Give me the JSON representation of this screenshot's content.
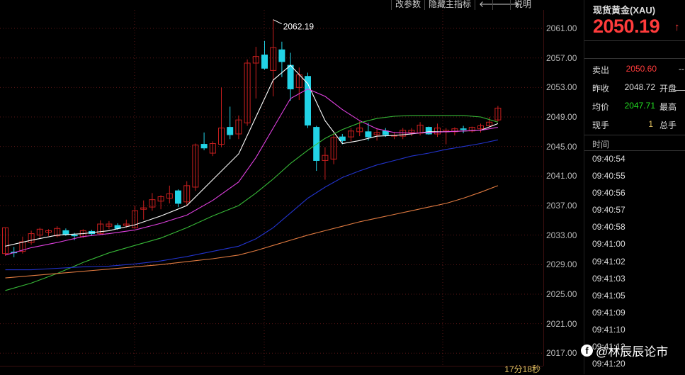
{
  "toolbar": {
    "params_label": "改参数",
    "hide_indicator_label": "隐藏主指标",
    "left_arrow": "🡐",
    "right_arrow": "🡒",
    "help_label": "说明"
  },
  "countdown": "17分18秒",
  "side_panel": {
    "title": "现货黄金(XAU)",
    "price": "2050.19",
    "price_arrow": "↑",
    "minus": "—",
    "rows": {
      "sell": {
        "label": "卖出",
        "value": "2050.60",
        "right_label": "--"
      },
      "prev_close": {
        "label": "昨收",
        "value": "2048.72",
        "right_label": "开盘"
      },
      "avg": {
        "label": "均价",
        "value": "2047.71",
        "right_label": "最高"
      },
      "volume": {
        "label": "现手",
        "value": "1",
        "right_label": "总手"
      }
    },
    "time_header": "时间",
    "times": [
      "09:40:54",
      "09:40:55",
      "09:40:56",
      "09:40:57",
      "09:40:58",
      "09:41:00",
      "09:41:02",
      "09:41:03",
      "09:41:05",
      "09:41:09",
      "09:41:10",
      "09:41:12",
      "09:41:20"
    ]
  },
  "watermark": "@林辰辰论市",
  "colors": {
    "up": "#c81e1e",
    "down": "#22d3e6",
    "price_red": "#ff3b3b",
    "green": "#22dd22",
    "ma_white": "#ffffff",
    "ma_magenta": "#e040e0",
    "ma_green": "#37b837",
    "ma_blue": "#2233cc",
    "ma_orange": "#e07a40"
  },
  "chart_data": {
    "type": "candlestick",
    "y_ticks": [
      "2061.00",
      "2057.00",
      "2053.00",
      "2049.00",
      "2045.00",
      "2041.00",
      "2037.00",
      "2033.00",
      "2029.00",
      "2025.00",
      "2021.00",
      "2017.00"
    ],
    "ylim": [
      2015.3,
      2063.5
    ],
    "high_annotation": "2062.19",
    "high_value": 2062.19,
    "high_index": 31,
    "candles": [
      {
        "o": 2030.5,
        "h": 2034.0,
        "l": 2030.2,
        "c": 2034.0
      },
      {
        "o": 2030.7,
        "h": 2031.4,
        "l": 2030.0,
        "c": 2030.6
      },
      {
        "o": 2030.8,
        "h": 2032.8,
        "l": 2030.5,
        "c": 2032.1
      },
      {
        "o": 2032.0,
        "h": 2033.6,
        "l": 2031.7,
        "c": 2033.2
      },
      {
        "o": 2033.0,
        "h": 2034.0,
        "l": 2032.5,
        "c": 2033.8
      },
      {
        "o": 2033.4,
        "h": 2033.8,
        "l": 2032.9,
        "c": 2033.6
      },
      {
        "o": 2032.9,
        "h": 2034.2,
        "l": 2032.7,
        "c": 2033.9
      },
      {
        "o": 2033.6,
        "h": 2033.9,
        "l": 2032.9,
        "c": 2033.1
      },
      {
        "o": 2033.0,
        "h": 2033.3,
        "l": 2032.3,
        "c": 2032.9
      },
      {
        "o": 2032.8,
        "h": 2033.8,
        "l": 2032.6,
        "c": 2033.6
      },
      {
        "o": 2033.5,
        "h": 2033.7,
        "l": 2032.9,
        "c": 2033.2
      },
      {
        "o": 2033.2,
        "h": 2035.0,
        "l": 2033.1,
        "c": 2034.5
      },
      {
        "o": 2034.2,
        "h": 2034.9,
        "l": 2033.8,
        "c": 2034.5
      },
      {
        "o": 2034.3,
        "h": 2034.6,
        "l": 2033.7,
        "c": 2033.9
      },
      {
        "o": 2034.3,
        "h": 2035.1,
        "l": 2034.0,
        "c": 2034.5
      },
      {
        "o": 2034.0,
        "h": 2037.0,
        "l": 2033.9,
        "c": 2036.3
      },
      {
        "o": 2036.5,
        "h": 2037.7,
        "l": 2035.1,
        "c": 2036.7
      },
      {
        "o": 2036.8,
        "h": 2038.7,
        "l": 2036.3,
        "c": 2037.8
      },
      {
        "o": 2037.6,
        "h": 2038.4,
        "l": 2036.5,
        "c": 2038.2
      },
      {
        "o": 2038.0,
        "h": 2039.7,
        "l": 2037.3,
        "c": 2038.6
      },
      {
        "o": 2039.0,
        "h": 2039.2,
        "l": 2036.8,
        "c": 2037.3
      },
      {
        "o": 2037.5,
        "h": 2040.3,
        "l": 2037.0,
        "c": 2039.7
      },
      {
        "o": 2039.5,
        "h": 2045.4,
        "l": 2039.0,
        "c": 2045.2
      },
      {
        "o": 2045.3,
        "h": 2046.9,
        "l": 2044.5,
        "c": 2044.8
      },
      {
        "o": 2044.1,
        "h": 2045.7,
        "l": 2043.7,
        "c": 2045.4
      },
      {
        "o": 2045.3,
        "h": 2053.0,
        "l": 2044.9,
        "c": 2047.5
      },
      {
        "o": 2047.6,
        "h": 2050.4,
        "l": 2046.0,
        "c": 2046.6
      },
      {
        "o": 2046.7,
        "h": 2049.2,
        "l": 2046.0,
        "c": 2048.6
      },
      {
        "o": 2048.2,
        "h": 2056.8,
        "l": 2047.8,
        "c": 2056.3
      },
      {
        "o": 2056.3,
        "h": 2058.5,
        "l": 2051.5,
        "c": 2057.2
      },
      {
        "o": 2057.4,
        "h": 2059.3,
        "l": 2055.4,
        "c": 2055.6
      },
      {
        "o": 2055.3,
        "h": 2062.19,
        "l": 2051.8,
        "c": 2058.4
      },
      {
        "o": 2058.1,
        "h": 2059.2,
        "l": 2054.4,
        "c": 2056.5
      },
      {
        "o": 2056.0,
        "h": 2057.7,
        "l": 2051.2,
        "c": 2052.8
      },
      {
        "o": 2053.0,
        "h": 2055.7,
        "l": 2051.3,
        "c": 2054.7
      },
      {
        "o": 2054.5,
        "h": 2055.0,
        "l": 2047.5,
        "c": 2047.9
      },
      {
        "o": 2047.6,
        "h": 2047.8,
        "l": 2041.7,
        "c": 2043.1
      },
      {
        "o": 2043.1,
        "h": 2044.9,
        "l": 2040.5,
        "c": 2043.8
      },
      {
        "o": 2043.3,
        "h": 2046.7,
        "l": 2042.6,
        "c": 2046.2
      },
      {
        "o": 2046.3,
        "h": 2046.7,
        "l": 2045.3,
        "c": 2045.8
      },
      {
        "o": 2046.3,
        "h": 2047.5,
        "l": 2045.7,
        "c": 2047.1
      },
      {
        "o": 2047.0,
        "h": 2048.4,
        "l": 2046.4,
        "c": 2047.5
      },
      {
        "o": 2047.0,
        "h": 2048.2,
        "l": 2045.8,
        "c": 2046.3
      },
      {
        "o": 2046.6,
        "h": 2047.5,
        "l": 2045.8,
        "c": 2046.9
      },
      {
        "o": 2047.1,
        "h": 2047.5,
        "l": 2046.3,
        "c": 2046.6
      },
      {
        "o": 2046.5,
        "h": 2047.0,
        "l": 2046.0,
        "c": 2046.5
      },
      {
        "o": 2046.4,
        "h": 2047.5,
        "l": 2046.0,
        "c": 2047.2
      },
      {
        "o": 2046.9,
        "h": 2047.5,
        "l": 2046.4,
        "c": 2047.2
      },
      {
        "o": 2046.8,
        "h": 2048.3,
        "l": 2046.5,
        "c": 2047.9
      },
      {
        "o": 2047.6,
        "h": 2047.7,
        "l": 2046.6,
        "c": 2046.7
      },
      {
        "o": 2046.7,
        "h": 2048.1,
        "l": 2046.3,
        "c": 2047.5
      },
      {
        "o": 2047.0,
        "h": 2047.5,
        "l": 2045.3,
        "c": 2047.2
      },
      {
        "o": 2047.0,
        "h": 2047.6,
        "l": 2046.5,
        "c": 2047.4
      },
      {
        "o": 2047.4,
        "h": 2047.8,
        "l": 2046.8,
        "c": 2047.3
      },
      {
        "o": 2047.1,
        "h": 2047.7,
        "l": 2046.9,
        "c": 2047.6
      },
      {
        "o": 2047.4,
        "h": 2048.1,
        "l": 2046.9,
        "c": 2047.8
      },
      {
        "o": 2047.8,
        "h": 2049.0,
        "l": 2047.7,
        "c": 2048.3
      },
      {
        "o": 2048.6,
        "h": 2050.5,
        "l": 2048.4,
        "c": 2050.2
      }
    ],
    "moving_averages": [
      {
        "color": "#ffffff",
        "points": [
          [
            0,
            2031.5
          ],
          [
            3,
            2032.3
          ],
          [
            6,
            2033.0
          ],
          [
            9,
            2033.2
          ],
          [
            12,
            2033.6
          ],
          [
            15,
            2034.4
          ],
          [
            18,
            2035.6
          ],
          [
            21,
            2037.0
          ],
          [
            24,
            2040.5
          ],
          [
            27,
            2044.0
          ],
          [
            29,
            2049.0
          ],
          [
            31,
            2054.0
          ],
          [
            33,
            2056.0
          ],
          [
            35,
            2053.5
          ],
          [
            37,
            2048.5
          ],
          [
            39,
            2045.4
          ],
          [
            41,
            2045.8
          ],
          [
            43,
            2046.4
          ],
          [
            45,
            2046.5
          ],
          [
            47,
            2046.7
          ],
          [
            49,
            2047.0
          ],
          [
            51,
            2047.0
          ],
          [
            53,
            2047.1
          ],
          [
            55,
            2047.2
          ],
          [
            57,
            2048.1
          ]
        ]
      },
      {
        "color": "#e040e0",
        "points": [
          [
            0,
            2030.3
          ],
          [
            3,
            2031.3
          ],
          [
            6,
            2032.0
          ],
          [
            9,
            2032.8
          ],
          [
            12,
            2033.2
          ],
          [
            15,
            2033.7
          ],
          [
            18,
            2034.6
          ],
          [
            21,
            2035.7
          ],
          [
            24,
            2037.7
          ],
          [
            27,
            2040.2
          ],
          [
            29,
            2043.5
          ],
          [
            31,
            2047.5
          ],
          [
            33,
            2051.5
          ],
          [
            35,
            2052.8
          ],
          [
            37,
            2051.8
          ],
          [
            39,
            2050.0
          ],
          [
            41,
            2048.5
          ],
          [
            43,
            2047.4
          ],
          [
            45,
            2046.9
          ],
          [
            47,
            2046.8
          ],
          [
            49,
            2046.9
          ],
          [
            51,
            2047.0
          ],
          [
            53,
            2047.1
          ],
          [
            55,
            2047.2
          ],
          [
            57,
            2047.6
          ]
        ]
      },
      {
        "color": "#37b837",
        "points": [
          [
            0,
            2025.5
          ],
          [
            3,
            2026.5
          ],
          [
            6,
            2027.8
          ],
          [
            9,
            2029.3
          ],
          [
            12,
            2030.6
          ],
          [
            15,
            2031.6
          ],
          [
            18,
            2032.6
          ],
          [
            21,
            2034.0
          ],
          [
            24,
            2035.6
          ],
          [
            27,
            2037.0
          ],
          [
            29,
            2038.7
          ],
          [
            31,
            2040.6
          ],
          [
            33,
            2042.7
          ],
          [
            35,
            2044.5
          ],
          [
            37,
            2046.1
          ],
          [
            39,
            2047.3
          ],
          [
            41,
            2048.2
          ],
          [
            43,
            2048.8
          ],
          [
            45,
            2049.1
          ],
          [
            47,
            2049.2
          ],
          [
            49,
            2049.2
          ],
          [
            51,
            2049.2
          ],
          [
            53,
            2049.2
          ],
          [
            55,
            2049.0
          ],
          [
            57,
            2048.3
          ]
        ]
      },
      {
        "color": "#2233cc",
        "points": [
          [
            0,
            2028.3
          ],
          [
            3,
            2028.3
          ],
          [
            6,
            2028.5
          ],
          [
            9,
            2028.7
          ],
          [
            12,
            2028.8
          ],
          [
            15,
            2029.1
          ],
          [
            18,
            2029.5
          ],
          [
            21,
            2030.1
          ],
          [
            24,
            2030.8
          ],
          [
            27,
            2031.5
          ],
          [
            29,
            2032.5
          ],
          [
            31,
            2034.0
          ],
          [
            33,
            2036.0
          ],
          [
            35,
            2038.0
          ],
          [
            37,
            2039.5
          ],
          [
            39,
            2040.8
          ],
          [
            41,
            2041.7
          ],
          [
            43,
            2042.5
          ],
          [
            45,
            2043.1
          ],
          [
            47,
            2043.7
          ],
          [
            49,
            2044.1
          ],
          [
            51,
            2044.6
          ],
          [
            53,
            2045.0
          ],
          [
            55,
            2045.4
          ],
          [
            57,
            2045.9
          ]
        ]
      },
      {
        "color": "#e07a40",
        "points": [
          [
            0,
            2027.2
          ],
          [
            3,
            2027.5
          ],
          [
            6,
            2027.8
          ],
          [
            9,
            2028.1
          ],
          [
            12,
            2028.4
          ],
          [
            15,
            2028.7
          ],
          [
            18,
            2029.0
          ],
          [
            21,
            2029.4
          ],
          [
            24,
            2029.8
          ],
          [
            27,
            2030.3
          ],
          [
            29,
            2030.9
          ],
          [
            31,
            2031.6
          ],
          [
            33,
            2032.3
          ],
          [
            35,
            2033.0
          ],
          [
            37,
            2033.6
          ],
          [
            39,
            2034.2
          ],
          [
            41,
            2034.8
          ],
          [
            43,
            2035.3
          ],
          [
            45,
            2035.8
          ],
          [
            47,
            2036.3
          ],
          [
            49,
            2036.8
          ],
          [
            51,
            2037.3
          ],
          [
            53,
            2038.0
          ],
          [
            55,
            2038.8
          ],
          [
            57,
            2039.7
          ]
        ]
      }
    ]
  }
}
